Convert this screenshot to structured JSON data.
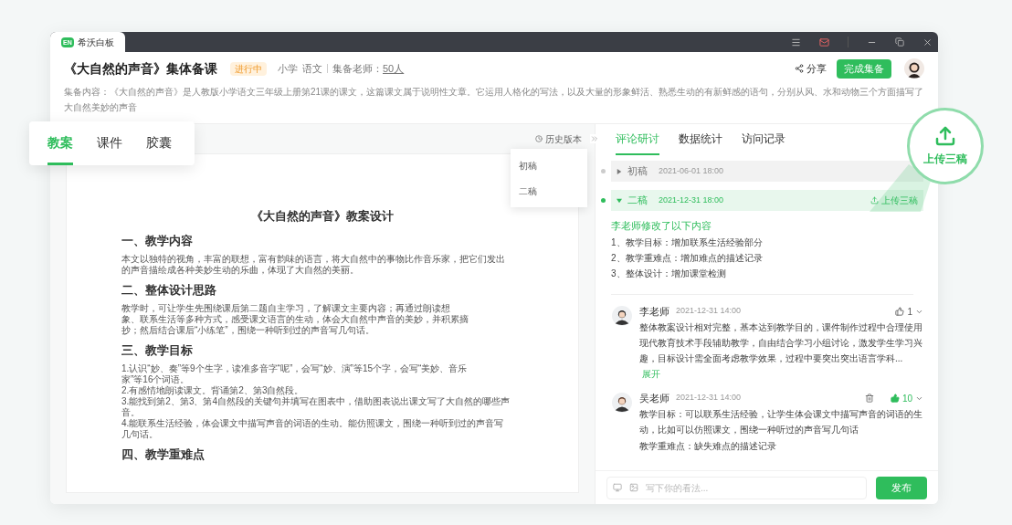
{
  "app": {
    "logo": "EN",
    "name": "希沃白板"
  },
  "header": {
    "title": "《大自然的声音》集体备课",
    "status": "进行中",
    "tags": [
      "小学",
      "语文"
    ],
    "teacher_label": "集备老师：",
    "teacher_count": "50人",
    "share": "分享",
    "finish": "完成集备",
    "description": "集备内容：《大自然的声音》是人教版小学语文三年级上册第21课的课文，这篇课文属于说明性文章。它运用人格化的写法，以及大量的形象鲜活、熟悉生动的有新鲜感的语句，分别从风、水和动物三个方面描写了大自然美妙的声音"
  },
  "doc_tabs": [
    {
      "label": "教案",
      "selected": true
    },
    {
      "label": "课件",
      "selected": false
    },
    {
      "label": "胶囊",
      "selected": false
    }
  ],
  "history": {
    "label": "历史版本",
    "items": [
      "初稿",
      "二稿"
    ]
  },
  "document": {
    "title": "《大自然的声音》教案设计",
    "sections": [
      {
        "heading": "一、教学内容",
        "lines": [
          "本文以独特的视角，丰富的联想，富有韵味的语言，将大自然中的事物比作音乐家，把它们发出",
          "的声音描绘成各种美妙生动的乐曲，体现了大自然的美丽。"
        ]
      },
      {
        "heading": "二、整体设计思路",
        "lines": [
          "教学时，可让学生先围绕课后第二题自主学习，了解课文主要内容；再通过朗读想",
          "象、联系生活等多种方式，感受课文语言的生动，体会大自然中声音的美妙，并积累摘",
          "抄；然后结合课后“小练笔”，围绕一种听到过的声音写几句话。"
        ]
      },
      {
        "heading": "三、教学目标",
        "lines": [
          "1.认识“妙、奏”等9个生字，读准多音字“呢”，会写“妙、演”等15个字，会写“美妙、音乐",
          "家”等16个词语。",
          "2.有感情地朗读课文。背诵第2、第3自然段。",
          "3.能找到第2、第3、第4自然段的关键句并填写在图表中，借助图表说出课文写了大自然的哪些声",
          "音。",
          "4.能联系生活经验，体会课文中描写声音的词语的生动。能仿照课文，围绕一种听到过的声音写",
          "几句话。"
        ]
      },
      {
        "heading": "四、教学重难点"
      }
    ]
  },
  "right_tabs": [
    {
      "label": "评论研讨",
      "selected": true
    },
    {
      "label": "数据统计",
      "selected": false
    },
    {
      "label": "访问记录",
      "selected": false
    }
  ],
  "versions": [
    {
      "label": "初稿",
      "time": "2021-06-01 18:00",
      "expanded": false
    },
    {
      "label": "二稿",
      "time": "2021-12-31 18:00",
      "expanded": true,
      "action": "上传三稿"
    }
  ],
  "change": {
    "author_line": "李老师修改了以下内容",
    "items": [
      "1、教学目标：增加联系生活经验部分",
      "2、教学重难点：增加难点的描述记录",
      "3、整体设计：增加课堂检测"
    ]
  },
  "comments": [
    {
      "author": "李老师",
      "time": "2021-12-31 14:00",
      "likes": "1",
      "liked": false,
      "deletable": false,
      "paragraphs": [
        "整体教案设计相对完整，基本达到教学目的，课件制作过程中合理使用现代教育技术手段辅助教学，自由结合学习小组讨论，激发学生学习兴趣，目标设计需全面考虑教学效果，过程中要突出突出语言学科..."
      ],
      "expand": "展开"
    },
    {
      "author": "吴老师",
      "time": "2021-12-31 14:00",
      "likes": "10",
      "liked": true,
      "deletable": true,
      "paragraphs": [
        "教学目标：可以联系生活经验，让学生体会课文中描写声音的词语的生动，比如可以仿照课文，围绕一种听过的声音写几句话",
        "教学重难点：缺失难点的描述记录"
      ]
    }
  ],
  "composer": {
    "placeholder": "写下你的看法...",
    "submit": "发布"
  },
  "callout": {
    "label": "上传三稿"
  }
}
